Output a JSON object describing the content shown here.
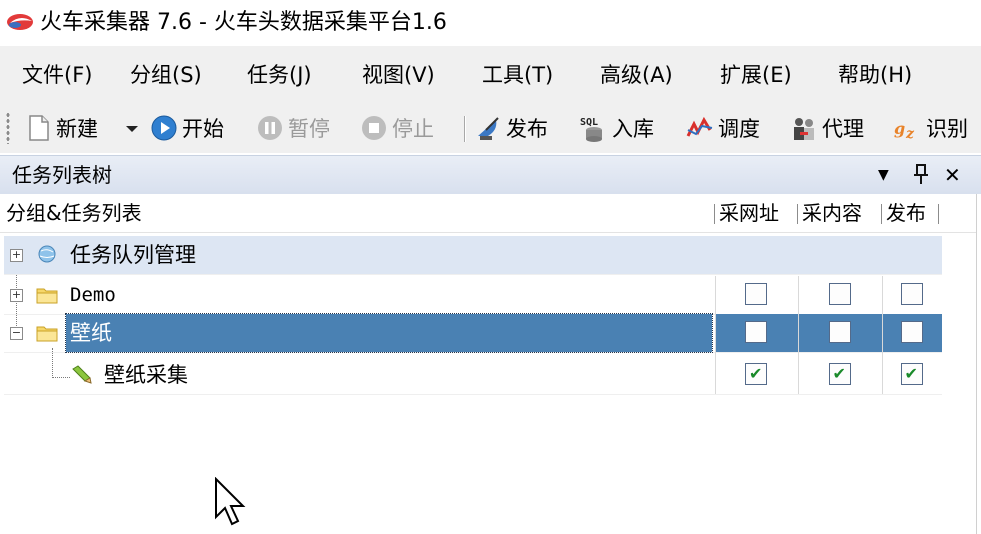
{
  "window": {
    "title": "火车采集器 7.6 - 火车头数据采集平台1.6",
    "app_icon": "train-logo-icon"
  },
  "menu": [
    {
      "label": "文件(F)"
    },
    {
      "label": "分组(S)"
    },
    {
      "label": "任务(J)"
    },
    {
      "label": "视图(V)"
    },
    {
      "label": "工具(T)"
    },
    {
      "label": "高级(A)"
    },
    {
      "label": "扩展(E)"
    },
    {
      "label": "帮助(H)"
    }
  ],
  "toolbar": {
    "new": {
      "label": "新建",
      "icon": "new-document-icon"
    },
    "start": {
      "label": "开始",
      "icon": "play-icon"
    },
    "pause": {
      "label": "暂停",
      "icon": "pause-icon",
      "disabled": true
    },
    "stop": {
      "label": "停止",
      "icon": "stop-icon",
      "disabled": true
    },
    "publish": {
      "label": "发布",
      "icon": "satellite-icon"
    },
    "import": {
      "label": "入库",
      "icon": "sql-database-icon"
    },
    "schedule": {
      "label": "调度",
      "icon": "schedule-chart-icon"
    },
    "proxy": {
      "label": "代理",
      "icon": "proxy-people-icon"
    },
    "recognize": {
      "label": "识别",
      "icon": "captcha-recognize-icon"
    }
  },
  "panel": {
    "title": "任务列表树",
    "buttons": [
      "▼",
      "ᵖ",
      "✕"
    ]
  },
  "columns": {
    "tree": "分组&任务列表",
    "collect_url": "采网址",
    "collect_content": "采内容",
    "publish": "发布"
  },
  "tree": [
    {
      "label": "任务队列管理",
      "type": "queue",
      "expander": "+",
      "icon": "globe-icon"
    },
    {
      "label": "Demo",
      "type": "folder",
      "expander": "+",
      "icon": "folder-icon",
      "checks": [
        false,
        false,
        false
      ]
    },
    {
      "label": "壁纸",
      "type": "folder",
      "expander": "−",
      "icon": "folder-icon",
      "selected": true,
      "checks": [
        false,
        false,
        false
      ]
    },
    {
      "label": "壁纸采集",
      "type": "task",
      "icon": "pencil-task-icon",
      "checks": [
        true,
        true,
        true
      ]
    }
  ],
  "colors": {
    "selection": "#4a81b3",
    "queue_row": "#dde6f3",
    "panel_header": "#d8e0ee",
    "check": "#1a8a2a"
  }
}
